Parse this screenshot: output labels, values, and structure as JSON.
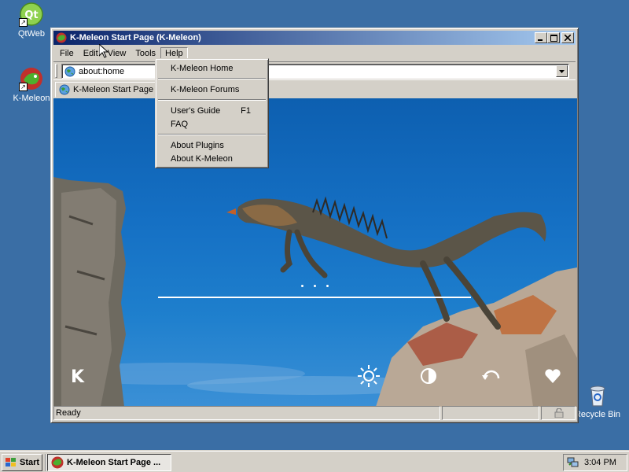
{
  "desktop": {
    "icons": [
      {
        "label": "QtWeb",
        "icon": "qtweb-icon"
      },
      {
        "label": "K-Meleon",
        "icon": "kmeleon-icon"
      },
      {
        "label": "Recycle Bin",
        "icon": "recycle-bin-icon"
      }
    ],
    "background_color": "#3a6ea5"
  },
  "window": {
    "title": "K-Meleon Start Page (K-Meleon)",
    "menus": [
      "File",
      "Edit",
      "View",
      "Tools",
      "Help"
    ],
    "active_menu": "Help",
    "address": "about:home",
    "tab_label": "K-Meleon Start Page",
    "status": "Ready"
  },
  "help_menu": {
    "groups": [
      [
        {
          "label": "K-Meleon Home",
          "shortcut": ""
        }
      ],
      [
        {
          "label": "K-Meleon Forums",
          "shortcut": ""
        }
      ],
      [
        {
          "label": "User's Guide",
          "shortcut": "F1"
        },
        {
          "label": "FAQ",
          "shortcut": ""
        }
      ],
      [
        {
          "label": "About Plugins",
          "shortcut": ""
        },
        {
          "label": "About K-Meleon",
          "shortcut": ""
        }
      ]
    ]
  },
  "start_page": {
    "logo_letter": "K",
    "bottom_icons": [
      "sun-icon",
      "contrast-icon",
      "undo-icon",
      "heart-icon"
    ],
    "search_value": ""
  },
  "taskbar": {
    "start_label": "Start",
    "task_label": "K-Meleon Start Page ...",
    "clock": "3:04 PM"
  },
  "colors": {
    "title_start": "#0a246a",
    "title_end": "#a6caf0",
    "face": "#d4d0c8"
  }
}
